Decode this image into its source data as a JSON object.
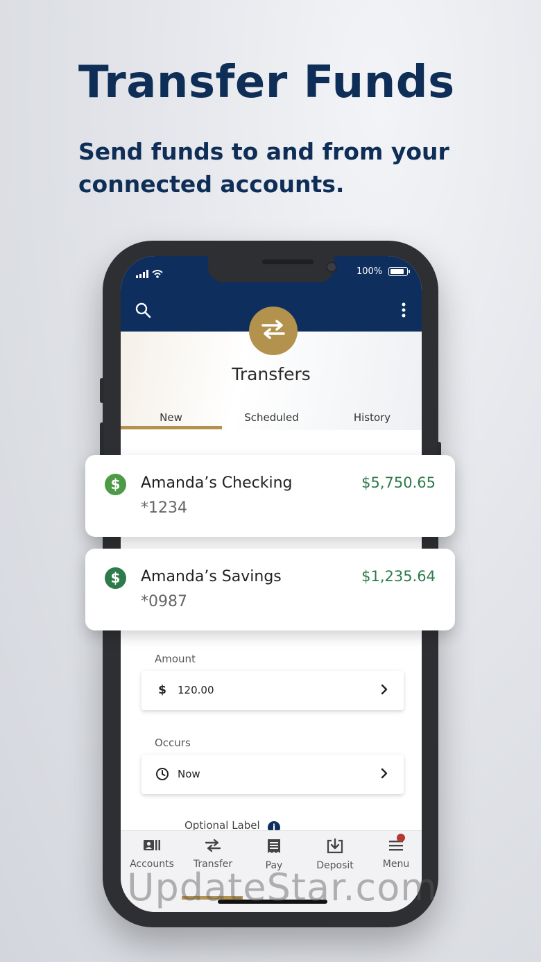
{
  "promo": {
    "headline": "Transfer Funds",
    "subheadline": "Send funds to and from your connected accounts."
  },
  "status_bar": {
    "battery_percent": "100%"
  },
  "header": {
    "title": "Transfers"
  },
  "tabs": [
    "New",
    "Scheduled",
    "History"
  ],
  "active_tab": "New",
  "accounts": [
    {
      "name": "Amanda’s Checking",
      "number": "*1234",
      "balance": "$5,750.65",
      "icon_color": "#4e9a47"
    },
    {
      "name": "Amanda’s Savings",
      "number": "*0987",
      "balance": "$1,235.64",
      "icon_color": "#2d7a4a"
    }
  ],
  "amount": {
    "label": "Amount",
    "currency_symbol": "$",
    "value": "120.00"
  },
  "occurs": {
    "label": "Occurs",
    "value": "Now"
  },
  "optional_label": {
    "text": "Optional Label",
    "info": "i"
  },
  "bottom_nav": [
    {
      "label": "Accounts",
      "icon": "accounts-icon"
    },
    {
      "label": "Transfer",
      "icon": "transfer-icon",
      "active": true
    },
    {
      "label": "Pay",
      "icon": "pay-icon"
    },
    {
      "label": "Deposit",
      "icon": "deposit-icon"
    },
    {
      "label": "Menu",
      "icon": "menu-icon",
      "badge": true
    }
  ],
  "watermark": "UpdateStar.com",
  "colors": {
    "navy": "#0e2f5e",
    "gold": "#b3924e",
    "balance_green": "#2d7a4a",
    "notification": "#b3382f"
  }
}
